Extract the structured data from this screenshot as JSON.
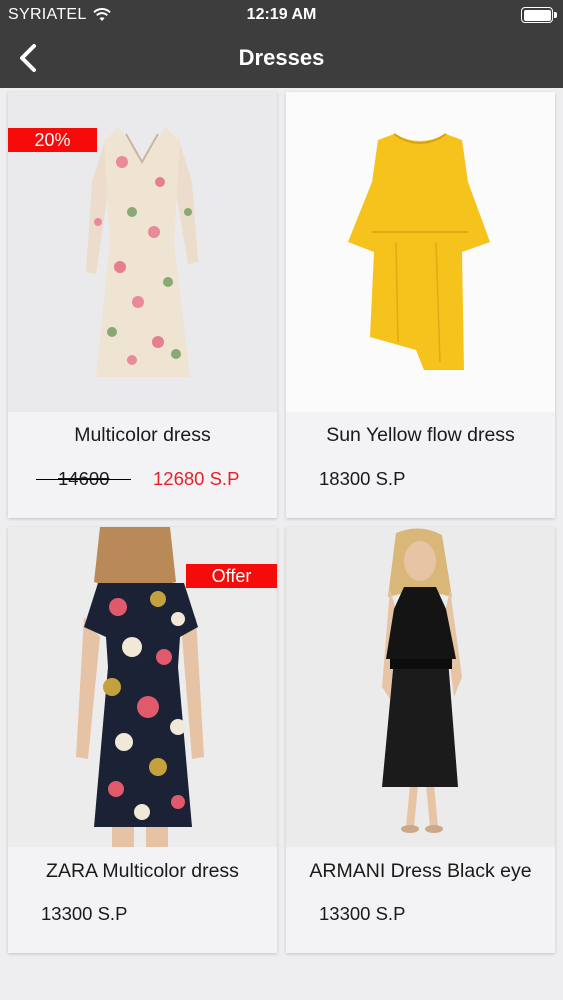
{
  "status_bar": {
    "carrier": "SYRIATEL",
    "time": "12:19 AM"
  },
  "header": {
    "title": "Dresses"
  },
  "products": [
    {
      "name": "Multicolor dress",
      "old_price": "14600",
      "price": "12680 S.P",
      "badge": "20%"
    },
    {
      "name": "Sun Yellow flow dress",
      "price": "18300 S.P"
    },
    {
      "name": "ZARA Multicolor dress",
      "price": "13300 S.P",
      "badge": "Offer"
    },
    {
      "name": "ARMANI Dress Black eye",
      "price": "13300 S.P"
    }
  ],
  "colors": {
    "header_bg": "#3d3d3d",
    "badge": "#f70a0a",
    "sale_price": "#e8202a"
  }
}
